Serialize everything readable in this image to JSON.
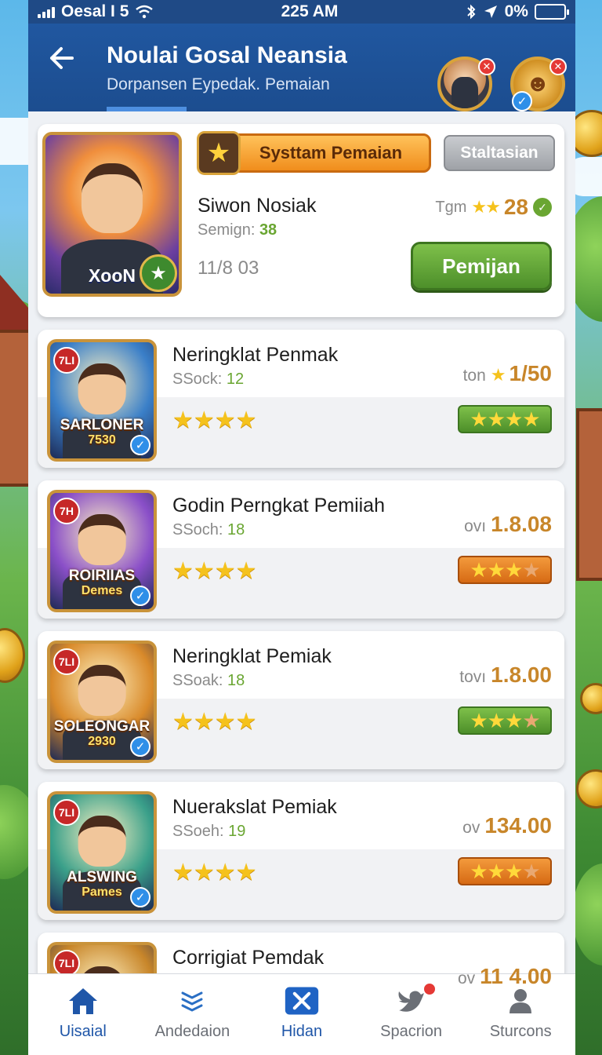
{
  "status_bar": {
    "carrier": "Oesal I 5",
    "time": "225 AM",
    "battery": "0%"
  },
  "header": {
    "title": "Noulai Gosal Neansia",
    "subtitle": "Dorpansen Eypedak. Pemaian"
  },
  "featured": {
    "thumb_label": "XooN",
    "tag_primary": "Systtam Pemaian",
    "tag_secondary": "Staltasian",
    "name": "Siwon Nosiak",
    "meta_label": "Semign:",
    "meta_value": "38",
    "date": "11/8 03",
    "score_label": "Tgm",
    "score_value": "28",
    "action_label": "Pemijan"
  },
  "items": [
    {
      "level": "7LI",
      "thumb_title": "SARLONER",
      "thumb_sub": "7530",
      "thumb_color": "#3a7fc8",
      "name": "Neringklat Penmak",
      "meta_label": "SSock:",
      "meta_value": "12",
      "score_prefix": "ton",
      "score_value": "1/50",
      "score_star": true,
      "rating": 4,
      "rating_box": "green"
    },
    {
      "level": "7H",
      "thumb_title": "ROIRIIAS",
      "thumb_sub": "Demes",
      "thumb_color": "#8a4fc8",
      "name": "Godin Perngkat Pemiiah",
      "meta_label": "SSoch:",
      "meta_value": "18",
      "score_prefix": "ovı",
      "score_value": "1.8.08",
      "score_star": false,
      "rating": 3,
      "rating_box": "orange"
    },
    {
      "level": "7LI",
      "thumb_title": "SOLEONGAR",
      "thumb_sub": "2930",
      "thumb_color": "#d98a2a",
      "name": "Neringklat Pemiak",
      "meta_label": "SSoak:",
      "meta_value": "18",
      "score_prefix": "tovı",
      "score_value": "1.8.00",
      "score_star": false,
      "rating": 3,
      "rating_box": "green"
    },
    {
      "level": "7LI",
      "thumb_title": "ALSWING",
      "thumb_sub": "Pames",
      "thumb_color": "#3aa08a",
      "name": "Nuerakslat Pemiak",
      "meta_label": "SSoeh:",
      "meta_value": "19",
      "score_prefix": "ov",
      "score_value": "134.00",
      "score_star": false,
      "rating": 3,
      "rating_box": "orange"
    },
    {
      "level": "7LI",
      "thumb_title": "",
      "thumb_sub": "",
      "thumb_color": "#c8862a",
      "name": "Corrigiat Pemdak",
      "meta_label": "",
      "meta_value": "",
      "score_prefix": "ov",
      "score_value": "11 4.00",
      "score_star": false,
      "rating": 0,
      "rating_box": ""
    }
  ],
  "tabs": [
    {
      "label": "Uisaial",
      "icon": "home-icon",
      "active": true
    },
    {
      "label": "Andedaion",
      "icon": "layers-icon",
      "active": false
    },
    {
      "label": "Hidan",
      "icon": "close-square-icon",
      "active": true
    },
    {
      "label": "Spacrion",
      "icon": "bird-icon",
      "active": false
    },
    {
      "label": "Sturcons",
      "icon": "user-icon",
      "active": false
    }
  ],
  "colors": {
    "header_bg": "#1f4a86",
    "accent": "#1f56a8",
    "score": "#c8862a",
    "action_green": "#5ea235",
    "rating_orange": "#e07a20"
  }
}
